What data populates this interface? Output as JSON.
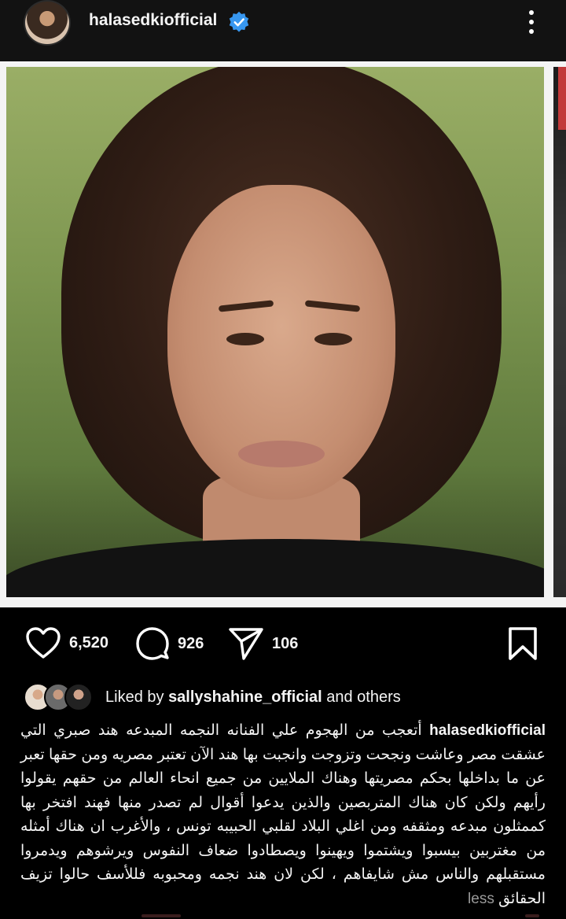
{
  "header": {
    "username": "halasedkiofficial",
    "verified": true,
    "more_icon": "more-vertical-icon"
  },
  "post": {
    "image_alt_subject": "portrait",
    "carousel_has_next": true
  },
  "actions": {
    "like_count": "6,520",
    "comment_count": "926",
    "share_count": "106"
  },
  "liked_by": {
    "prefix": "Liked by ",
    "user": "sallyshahine_official",
    "suffix": " and others"
  },
  "caption": {
    "username": "halasedkiofficial",
    "text": "أتعجب من الهجوم علي الفنانه النجمه المبدعه هند صبري التي عشقت مصر وعاشت ونجحت وتزوجت وانجبت بها هند الآن تعتبر مصريه ومن حقها تعبر عن ما بداخلها بحكم مصريتها وهناك الملايين من جميع انحاء العالم من حقهم يقولوا رأيهم ولكن كان هناك المتربصين والذين يدعوا أقوال لم تصدر منها فهند افتخر بها كممثلون مبدعه ومثقفه ومن اغلي البلاد لقلبي الحبيبه تونس ، والأغرب ان هناك أمثله من مغتربين بيسبوا ويشتموا ويهينوا ويصطادوا ضعاف النفوس ويرشوهم ويدمروا مستقبلهم والناس مش شايفاهم ، لكن لان هند نجمه ومحبوبه فللأسف حالوا تزيف الحقائق",
    "less_label": "less"
  }
}
